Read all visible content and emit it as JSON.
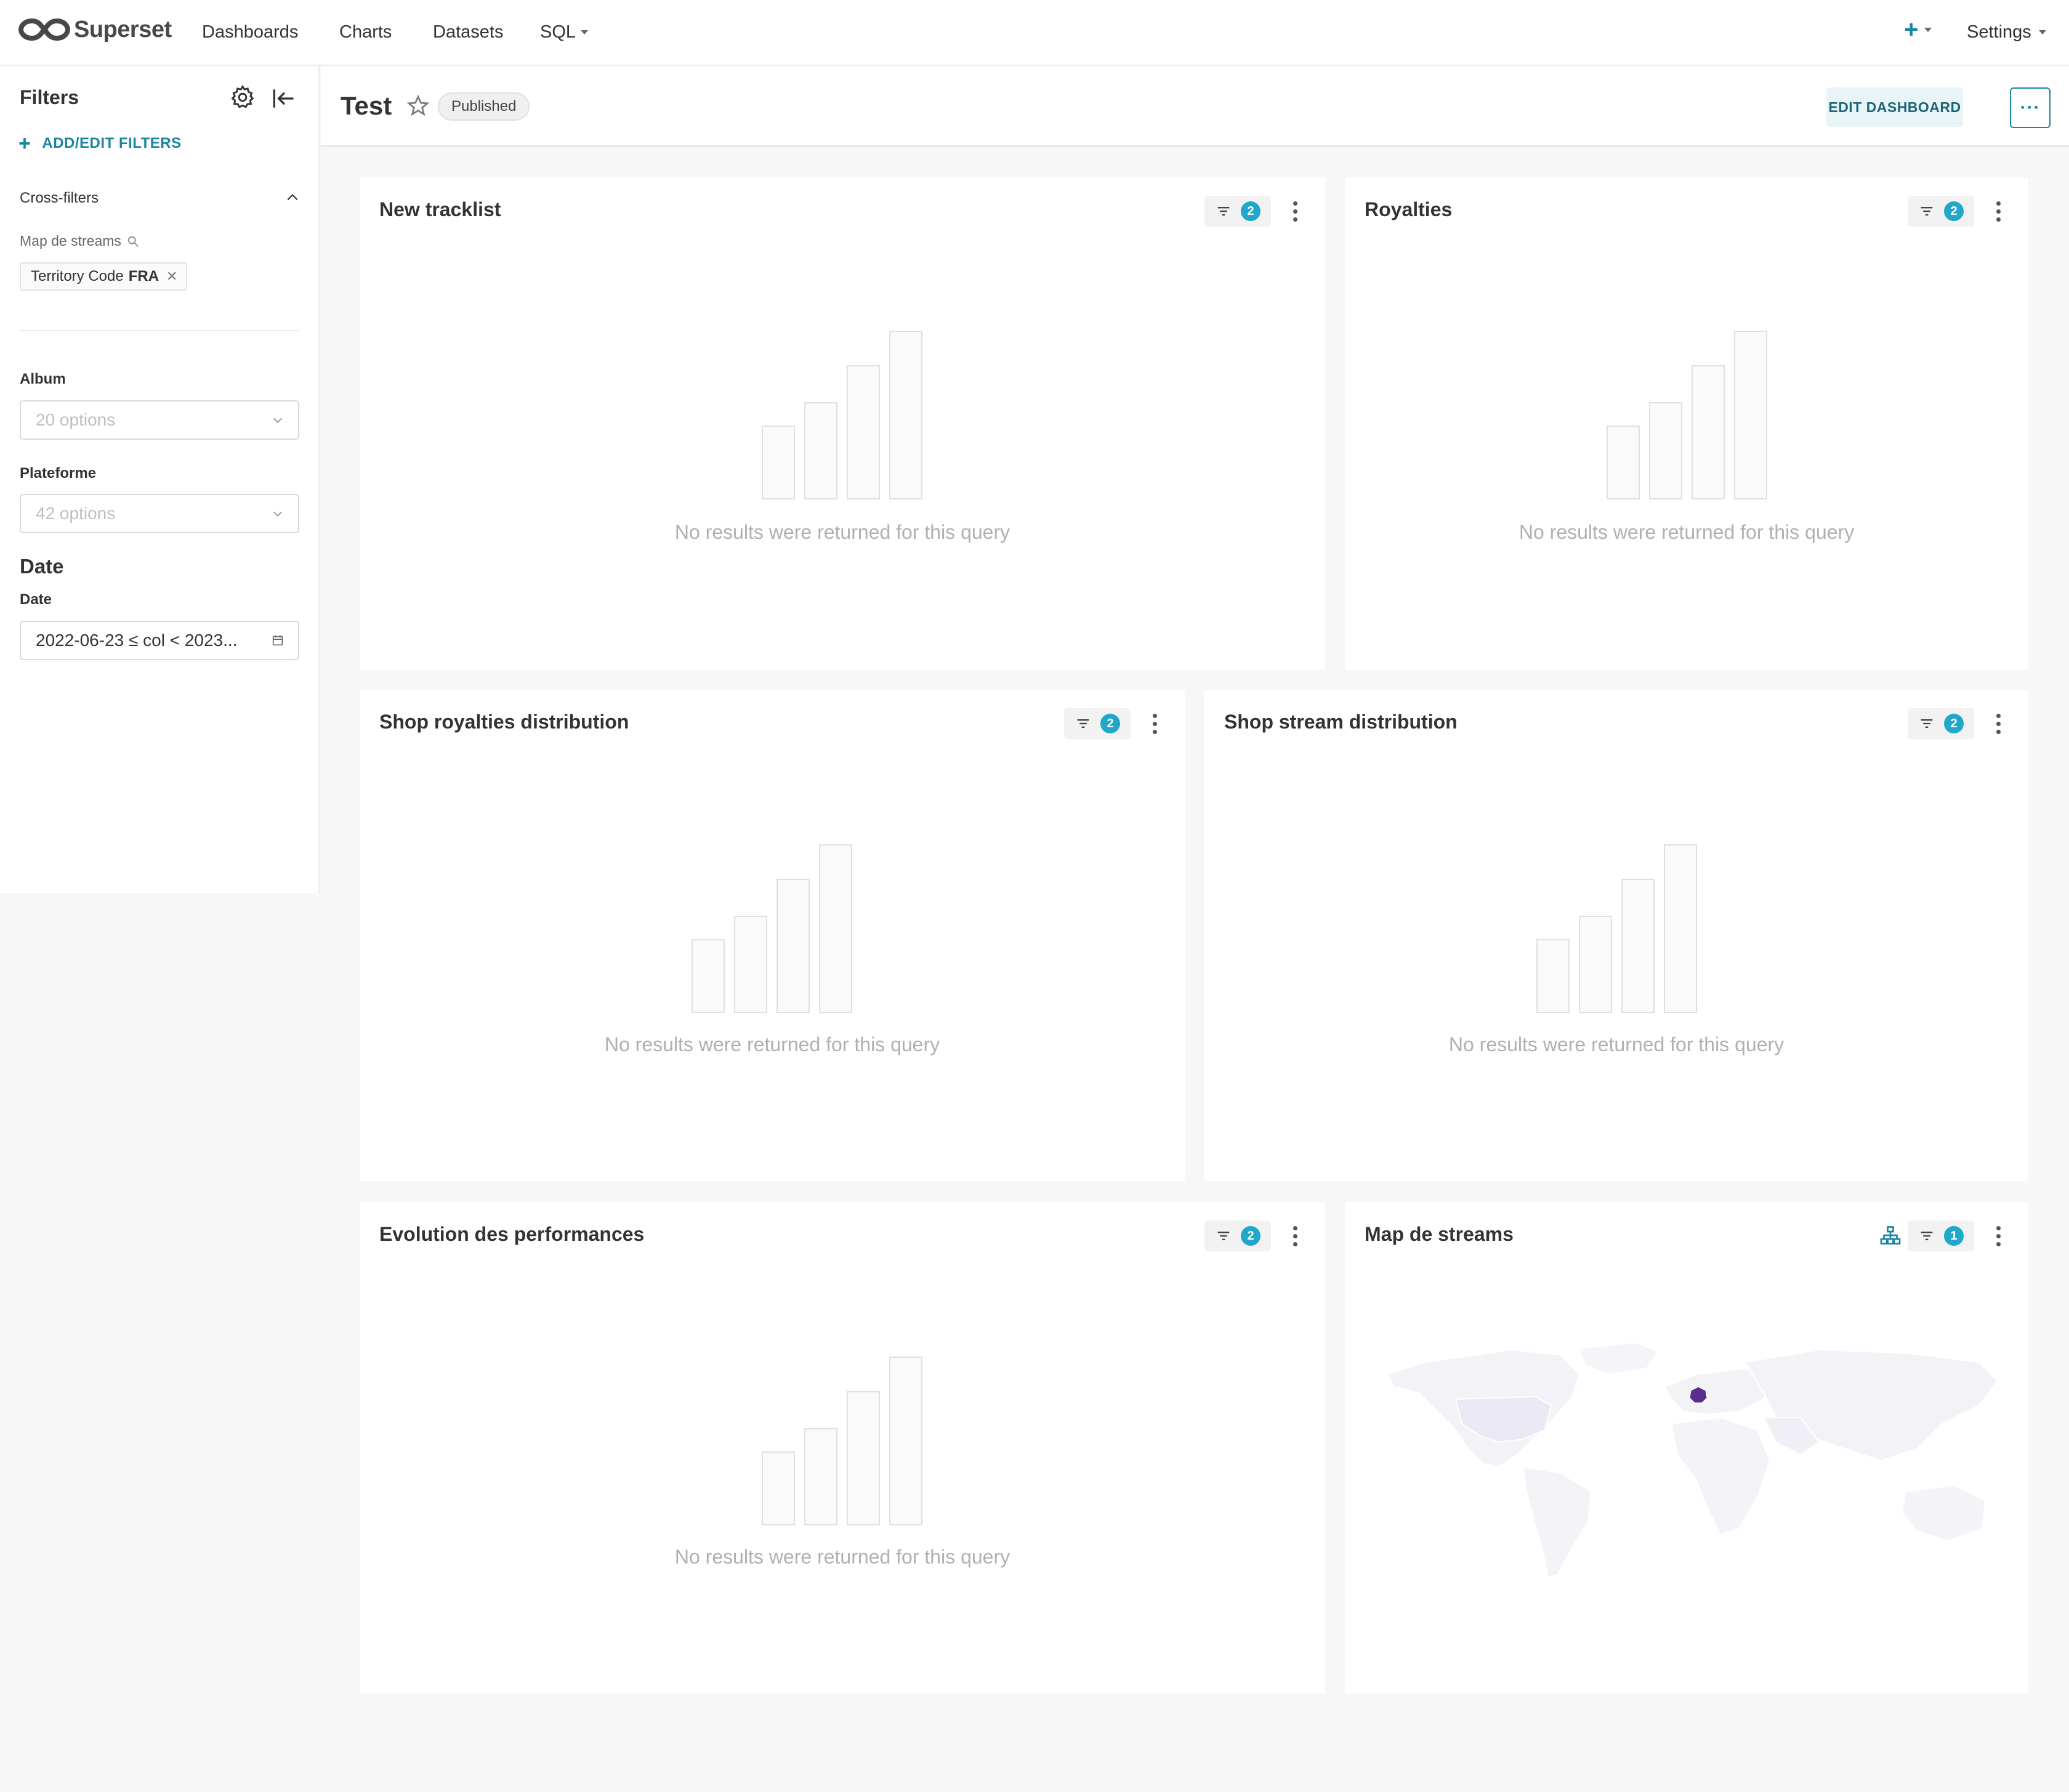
{
  "nav": {
    "brand": "Superset",
    "links": [
      "Dashboards",
      "Charts",
      "Datasets",
      "SQL"
    ],
    "settings": "Settings"
  },
  "sidebar": {
    "title": "Filters",
    "add_label": "ADD/EDIT FILTERS",
    "cross_filters": {
      "title": "Cross-filters",
      "source": "Map de streams",
      "tag_name": "Territory Code",
      "tag_value": "FRA"
    },
    "filters": [
      {
        "label": "Album",
        "placeholder": "20 options"
      },
      {
        "label": "Plateforme",
        "placeholder": "42 options"
      }
    ],
    "section_title": "Date",
    "date_label": "Date",
    "date_value": "2022-06-23 ≤ col < 2023..."
  },
  "header": {
    "title": "Test",
    "status": "Published",
    "edit_button": "EDIT DASHBOARD",
    "more_button": "···"
  },
  "empty_message": "No results were returned for this query",
  "cards": [
    {
      "title": "New tracklist",
      "filter_count": "2"
    },
    {
      "title": "Royalties",
      "filter_count": "2"
    },
    {
      "title": "Shop royalties distribution",
      "filter_count": "2"
    },
    {
      "title": "Shop stream distribution",
      "filter_count": "2"
    },
    {
      "title": "Evolution des performances",
      "filter_count": "2"
    },
    {
      "title": "Map de streams",
      "filter_count": "1",
      "highlighted_country": "France",
      "highlight_color": "#5b2c8e"
    }
  ],
  "colors": {
    "accent": "#1a85a0",
    "badge": "#20a7c9",
    "background": "#f7f7f7"
  },
  "icons": [
    "superset-logo-icon",
    "gear-icon",
    "collapse-icon",
    "plus-icon",
    "chevron-up-icon",
    "search-icon",
    "close-icon",
    "chevron-down-icon",
    "calendar-icon",
    "star-icon",
    "filter-icon",
    "more-vertical-icon",
    "hierarchy-icon"
  ]
}
